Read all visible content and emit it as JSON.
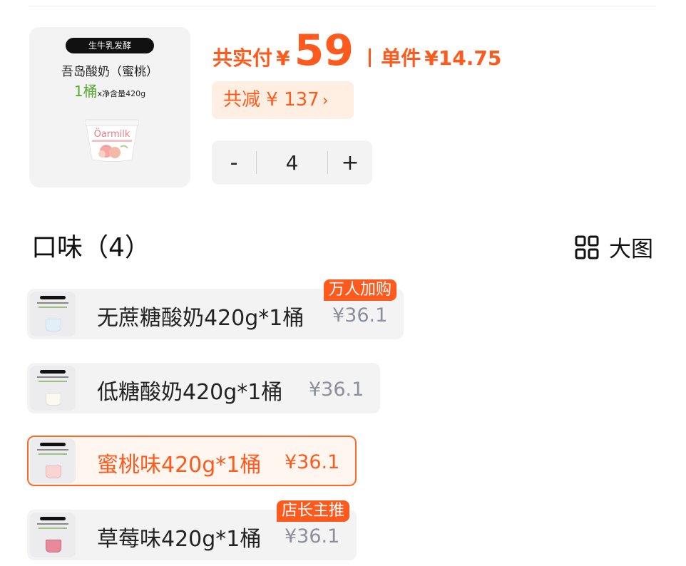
{
  "product": {
    "badge": "生牛乳发酵",
    "name": "吾岛酸奶（蜜桃）",
    "qty": "1桶",
    "net": "x净含量420g",
    "brand_logo": "Öarmilk"
  },
  "price": {
    "total_label": "共实付",
    "currency": "¥",
    "total_value": "59",
    "unit_label": "单件",
    "unit_value": "¥14.75",
    "discount_text": "共减 ¥ 137",
    "discount_chevron": "›"
  },
  "stepper": {
    "minus": "-",
    "value": "4",
    "plus": "+"
  },
  "section": {
    "title": "口味（4）",
    "big_view_label": "大图",
    "big_view_icon": "grid-icon"
  },
  "options": [
    {
      "name": "无蔗糖酸奶420g*1桶",
      "price": "¥36.1",
      "tag": "万人加购",
      "selected": false
    },
    {
      "name": "低糖酸奶420g*1桶",
      "price": "¥36.1",
      "tag": "",
      "selected": false
    },
    {
      "name": "蜜桃味420g*1桶",
      "price": "¥36.1",
      "tag": "",
      "selected": true
    },
    {
      "name": "草莓味420g*1桶",
      "price": "¥36.1",
      "tag": "店长主推",
      "selected": false
    }
  ],
  "colors": {
    "accent": "#ff5a1e",
    "accent_bg": "#ffeee2",
    "qty_green": "#5aa832",
    "muted_price": "#8a8f99"
  }
}
